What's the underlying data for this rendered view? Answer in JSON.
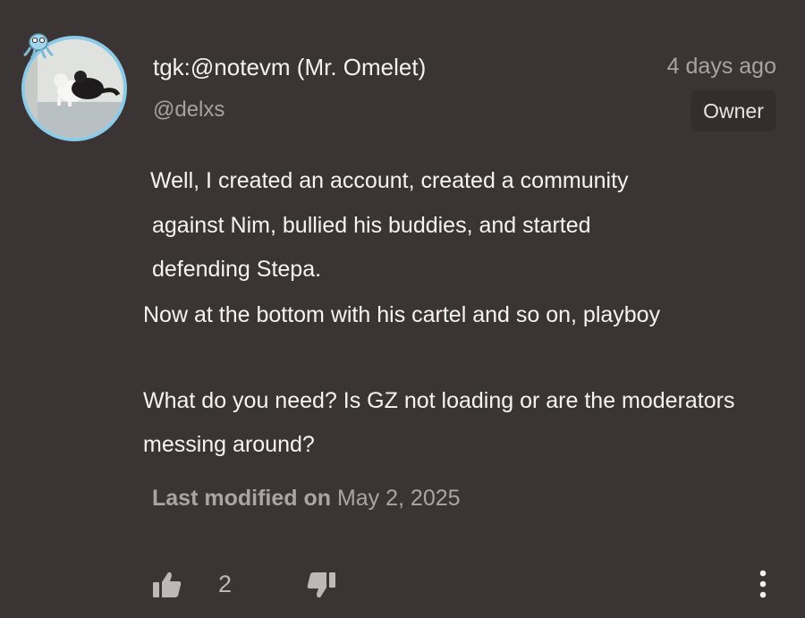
{
  "comment": {
    "author": "tgk:@notevm (Mr. Omelet)",
    "handle": "@delxs",
    "time": "4 days ago",
    "role": "Owner",
    "lines": [
      "Well, I created an account, created a community",
      "against Nim, bullied his buddies, and started",
      "defending Stepa.",
      "Now at the bottom with his cartel and so on, playboy",
      "What do you need? Is GZ not loading or are the moderators",
      "messing around?"
    ],
    "modified_label": "Last modified on",
    "modified_date": "May 2, 2025",
    "likes": "2"
  },
  "icons": {
    "like": "thumbs-up-icon",
    "dislike": "thumbs-down-icon",
    "menu": "more-vertical-icon",
    "avatar_badge": "octopus-icon"
  },
  "colors": {
    "background": "#3a3534",
    "avatar_ring": "#8ccbe7",
    "muted_text": "#a8a3a2"
  }
}
